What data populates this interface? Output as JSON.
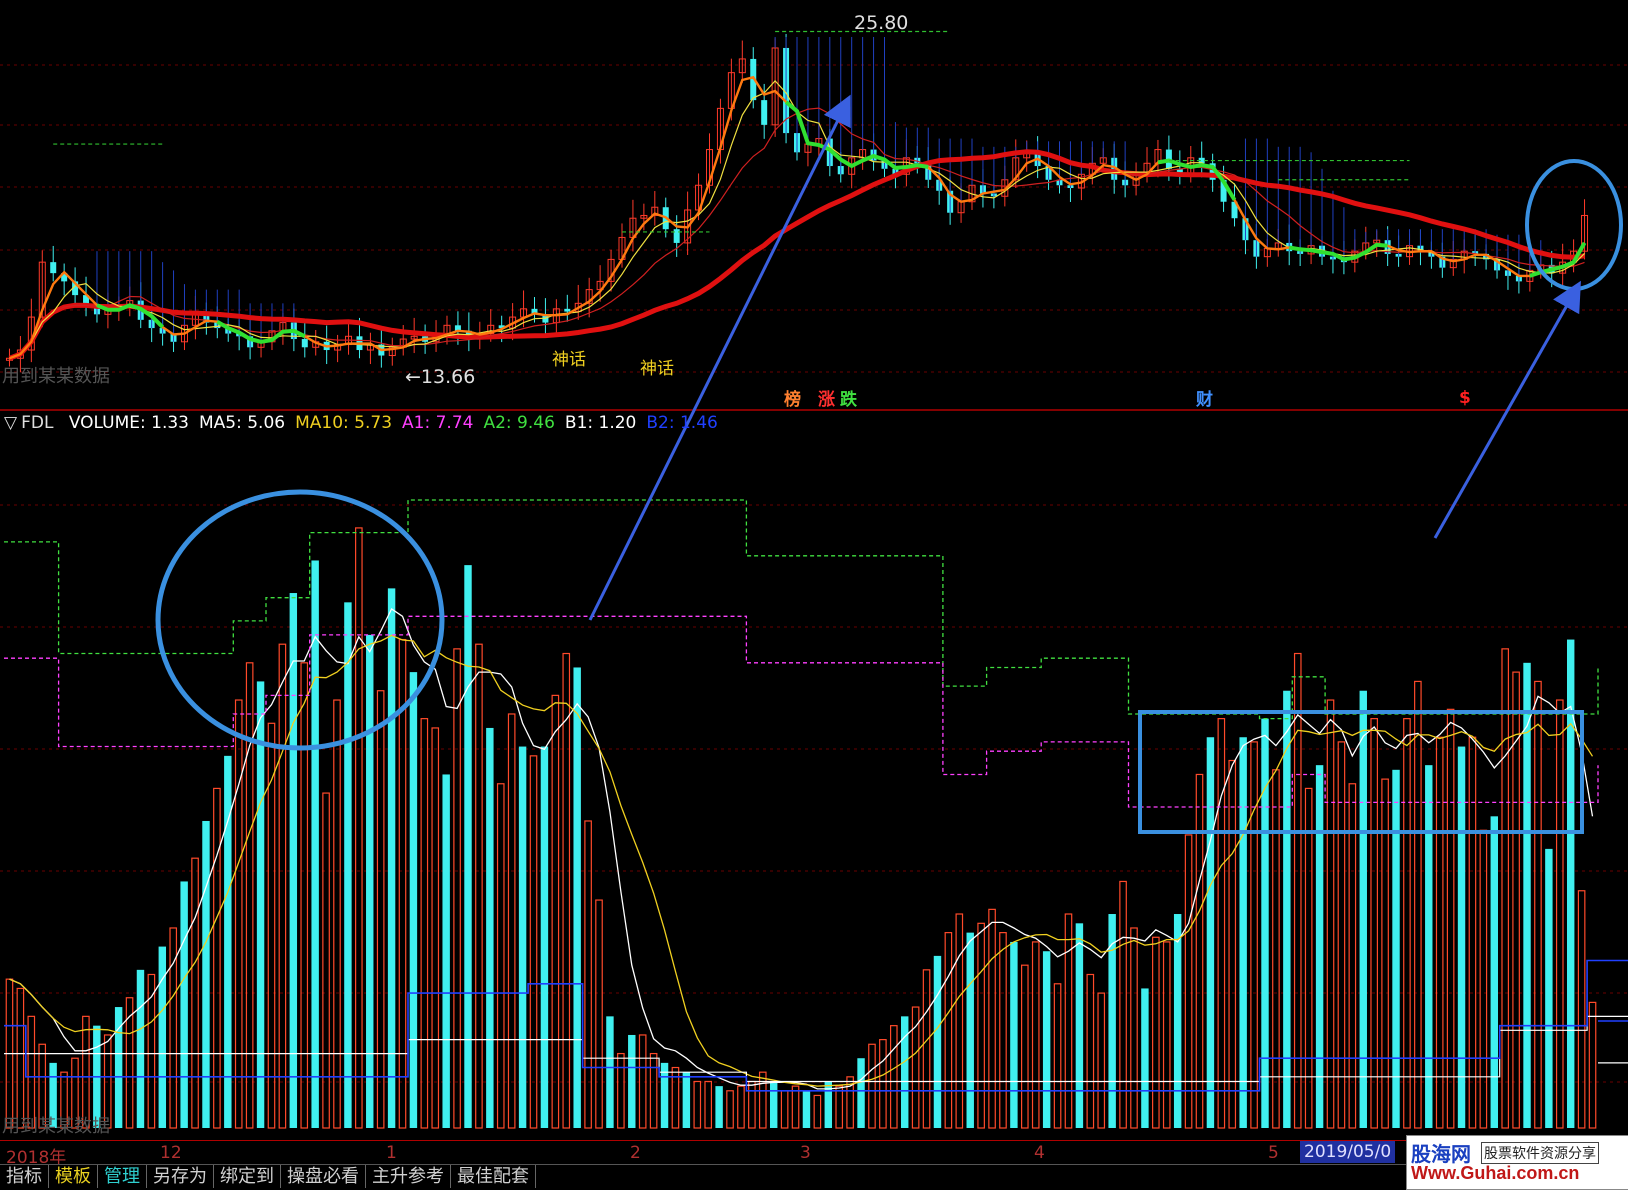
{
  "indicator_header": {
    "marker": "▽",
    "name": "FDL",
    "items": [
      {
        "label": "VOLUME:",
        "value": "1.33",
        "color": "#ffffff"
      },
      {
        "label": "MA5:",
        "value": "5.06",
        "color": "#ffffff"
      },
      {
        "label": "MA10:",
        "value": "5.73",
        "color": "#f0d020"
      },
      {
        "label": "A1:",
        "value": "7.74",
        "color": "#ff40ff"
      },
      {
        "label": "A2:",
        "value": "9.46",
        "color": "#40e040"
      },
      {
        "label": "B1:",
        "value": "1.20",
        "color": "#ffffff"
      },
      {
        "label": "B2:",
        "value": "1.46",
        "color": "#2040ff"
      }
    ]
  },
  "price_annotations": {
    "high": "25.80",
    "low": "←13.66",
    "signal_1": "神话",
    "signal_2": "神话",
    "watermark": "用到某某数据",
    "watermark_lower": "用到某某数据"
  },
  "event_tags": [
    {
      "text": "榜",
      "color": "#ff8030"
    },
    {
      "text": "涨",
      "color": "#ff3030"
    },
    {
      "text": "跌",
      "color": "#40e040"
    },
    {
      "text": "财",
      "color": "#4090ff"
    },
    {
      "text": "$",
      "color": "#ff2020"
    }
  ],
  "time_axis": {
    "labels": [
      "2018年",
      "12",
      "1",
      "2",
      "3",
      "4",
      "5"
    ],
    "current_date": "2019/05/0"
  },
  "bottom_tabs": [
    "指标",
    "模板",
    "管理",
    "另存为",
    "绑定到",
    "操盘必看",
    "主升参考",
    "最佳配套"
  ],
  "logo": {
    "title": "股海网",
    "tagline": "股票软件资源分享",
    "url": "Www.Guhai.com.cn"
  },
  "chart_data": {
    "type": "bar",
    "volume_series": {
      "name": "VOLUME",
      "values": [
        3.2,
        3.0,
        2.4,
        1.8,
        1.4,
        1.2,
        1.5,
        2.4,
        2.2,
        2.0,
        2.6,
        2.8,
        3.4,
        3.3,
        3.9,
        4.3,
        5.3,
        5.8,
        6.6,
        7.3,
        8.0,
        9.2,
        10.0,
        9.6,
        8.7,
        10.4,
        11.5,
        10.0,
        12.2,
        7.2,
        9.2,
        11.3,
        12.9,
        10.6,
        9.4,
        11.6,
        10.5,
        9.8,
        8.8,
        8.6,
        7.6,
        10.3,
        12.1,
        10.4,
        8.6,
        7.4,
        8.9,
        8.2,
        8.0,
        8.2,
        9.3,
        10.2,
        9.9,
        6.6,
        4.9,
        2.4,
        1.6,
        2.0,
        2.0,
        1.6,
        1.4,
        1.3,
        1.2,
        1.0,
        1.0,
        0.9,
        0.8,
        0.9,
        1.0,
        1.2,
        1.0,
        0.8,
        0.9,
        0.8,
        0.7,
        1.0,
        0.9,
        1.1,
        1.5,
        1.8,
        1.9,
        2.2,
        2.4,
        2.6,
        3.4,
        3.7,
        4.2,
        4.6,
        4.2,
        4.4,
        4.7,
        4.2,
        4.0,
        3.5,
        4.0,
        3.8,
        3.1,
        4.6,
        4.4,
        3.3,
        2.9,
        4.6,
        5.3,
        4.3,
        3.0,
        4.1,
        4.0,
        4.6,
        6.3,
        7.6,
        8.4,
        8.8,
        7.9,
        8.4,
        8.3,
        8.8,
        7.7,
        9.4,
        10.2,
        7.3,
        7.8,
        9.2,
        8.3,
        7.4,
        9.4,
        8.8,
        7.5,
        7.7,
        8.8,
        9.6,
        7.8,
        8.4,
        9.0,
        8.2,
        8.4,
        6.4,
        6.7,
        10.3,
        9.8,
        10.0,
        9.6,
        6.0,
        9.2,
        10.5,
        5.1,
        2.7
      ],
      "color_up": "#ff4a2a",
      "color_down": "#40f0f0"
    },
    "ma5": {
      "name": "MA5",
      "color": "#ffffff"
    },
    "ma10": {
      "name": "MA10",
      "color": "#f0d020"
    },
    "a1": {
      "name": "A1",
      "color": "#ff40ff"
    },
    "a2": {
      "name": "A2",
      "color": "#40e040"
    },
    "b1": {
      "name": "B1",
      "color": "#ffffff"
    },
    "b2": {
      "name": "B2",
      "color": "#2040ff"
    },
    "price": {
      "high_value": 25.8,
      "low_value": 13.66,
      "closes": [
        13.7,
        14.0,
        15.2,
        17.2,
        16.8,
        16.5,
        16.0,
        15.6,
        15.3,
        15.5,
        15.6,
        15.8,
        15.1,
        14.8,
        14.6,
        14.3,
        14.9,
        15.3,
        15.0,
        14.8,
        14.6,
        14.5,
        14.1,
        14.3,
        14.7,
        15.0,
        14.4,
        14.1,
        14.3,
        14.0,
        14.2,
        14.5,
        14.0,
        14.2,
        13.8,
        14.1,
        14.4,
        14.5,
        14.3,
        14.5,
        14.9,
        14.7,
        14.4,
        14.6,
        14.9,
        14.8,
        15.2,
        15.5,
        15.3,
        15.0,
        15.5,
        15.4,
        15.7,
        16.2,
        16.5,
        17.3,
        18.1,
        18.8,
        18.9,
        19.2,
        18.4,
        17.9,
        19.1,
        20.0,
        21.3,
        22.8,
        24.1,
        24.6,
        23.1,
        22.2,
        25.0,
        21.9,
        21.2,
        21.5,
        21.7,
        20.7,
        20.4,
        21.0,
        21.3,
        20.9,
        20.6,
        20.4,
        21.0,
        20.8,
        20.2,
        19.8,
        19.0,
        19.4,
        20.0,
        19.7,
        19.6,
        20.2,
        21.0,
        21.2,
        20.7,
        20.2,
        20.0,
        19.9,
        20.4,
        20.8,
        21.0,
        20.2,
        20.0,
        20.4,
        20.8,
        21.3,
        20.6,
        20.4,
        21.0,
        20.8,
        20.2,
        19.4,
        18.8,
        18.0,
        17.4,
        17.7,
        17.9,
        17.6,
        17.5,
        17.8,
        17.4,
        17.3,
        17.2,
        17.6,
        17.9,
        18.0,
        17.5,
        17.4,
        17.8,
        17.6,
        17.4,
        17.0,
        17.3,
        17.6,
        17.5,
        17.3,
        16.9,
        16.7,
        16.5,
        16.9,
        17.1,
        16.8,
        17.2,
        17.6,
        18.9
      ]
    }
  }
}
